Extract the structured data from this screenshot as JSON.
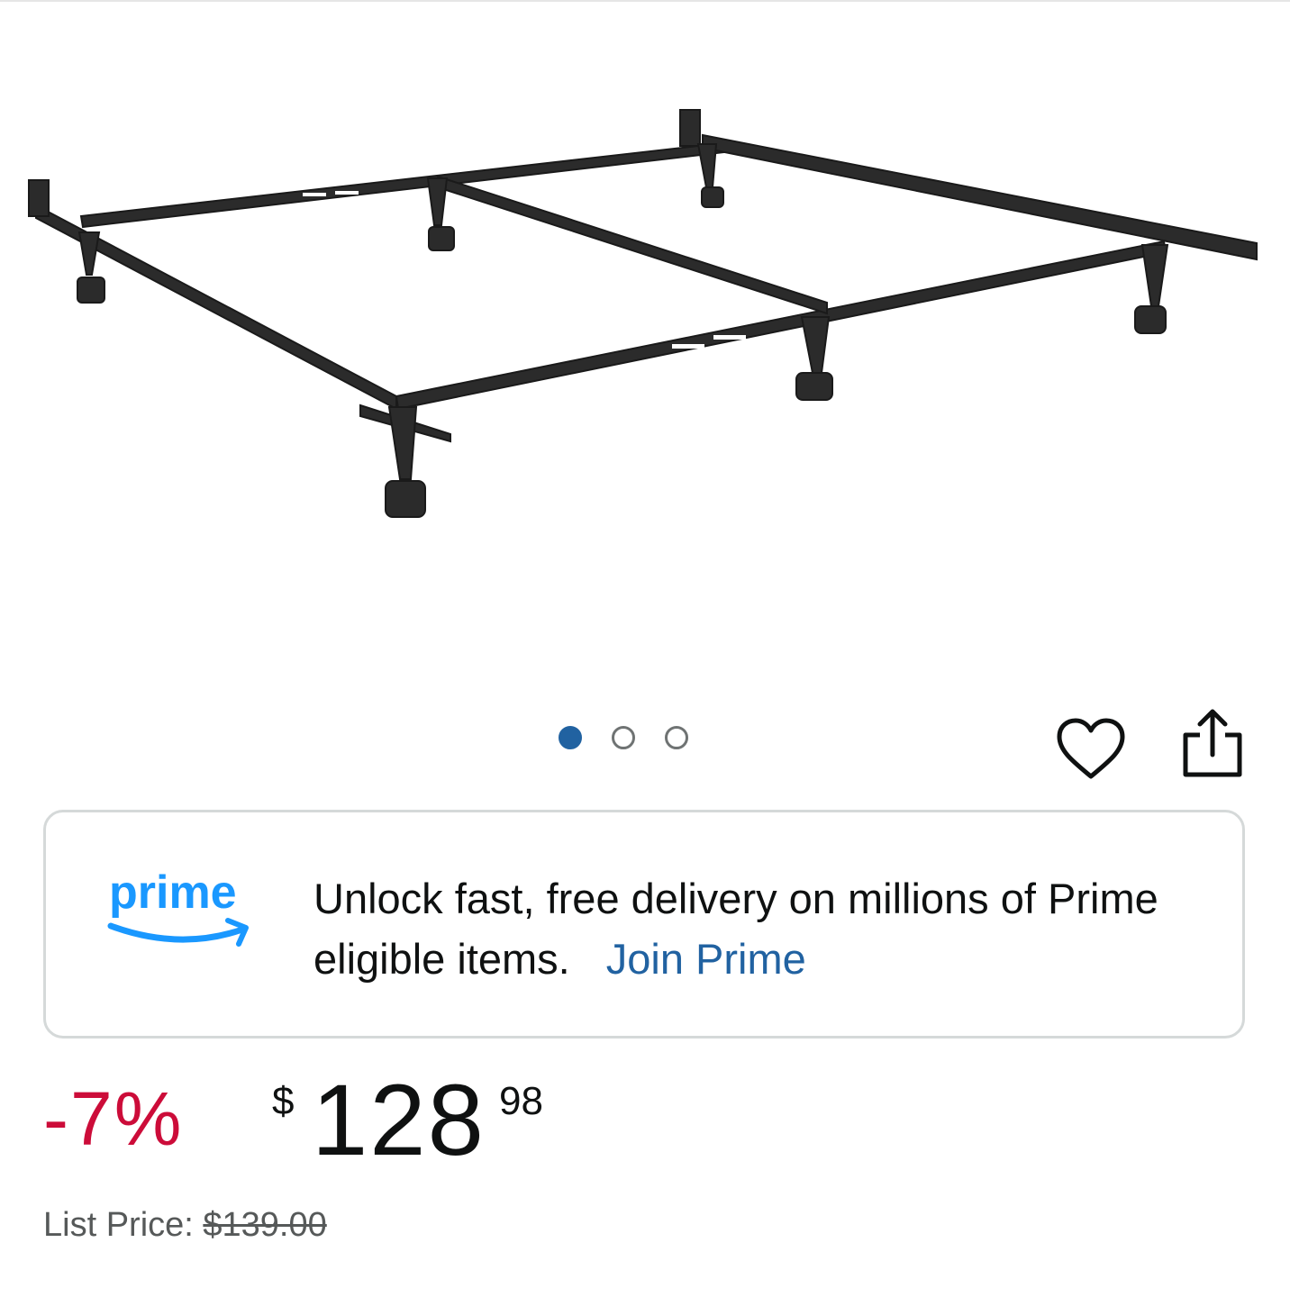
{
  "carousel": {
    "count": 3,
    "active_index": 0
  },
  "actions": {
    "wishlist_icon": "heart-icon",
    "share_icon": "share-icon"
  },
  "prime_banner": {
    "logo_text": "prime",
    "message": "Unlock fast, free delivery on millions of Prime eligible items.",
    "link_label": "Join Prime"
  },
  "pricing": {
    "discount": "-7%",
    "currency_symbol": "$",
    "price_whole": "128",
    "price_fraction": "98",
    "list_price_label": "List Price:",
    "list_price_value": "$139.00"
  },
  "colors": {
    "discount": "#cc0c39",
    "link": "#2162a1",
    "prime_blue": "#1a98ff",
    "active_dot": "#2162a1"
  }
}
